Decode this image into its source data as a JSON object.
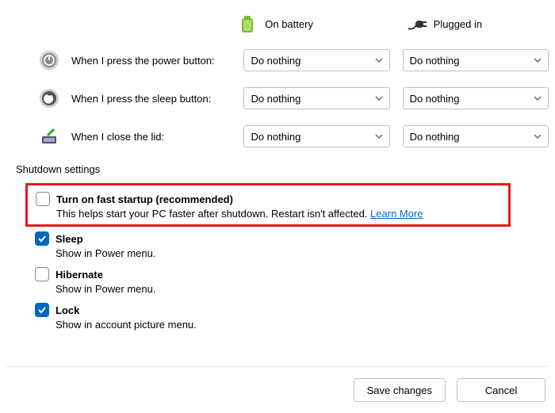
{
  "columnHeaders": {
    "battery": "On battery",
    "pluggedIn": "Plugged in"
  },
  "rows": {
    "powerButton": {
      "label": "When I press the power button:",
      "battery": "Do nothing",
      "plugged": "Do nothing"
    },
    "sleepButton": {
      "label": "When I press the sleep button:",
      "battery": "Do nothing",
      "plugged": "Do nothing"
    },
    "closeLid": {
      "label": "When I close the lid:",
      "battery": "Do nothing",
      "plugged": "Do nothing"
    }
  },
  "shutdownSection": "Shutdown settings",
  "options": {
    "fastStartup": {
      "title": "Turn on fast startup (recommended)",
      "desc": "This helps start your PC faster after shutdown. Restart isn't affected.",
      "learn": "Learn More",
      "checked": false
    },
    "sleep": {
      "title": "Sleep",
      "desc": "Show in Power menu.",
      "checked": true
    },
    "hibernate": {
      "title": "Hibernate",
      "desc": "Show in Power menu.",
      "checked": false
    },
    "lock": {
      "title": "Lock",
      "desc": "Show in account picture menu.",
      "checked": true
    }
  },
  "buttons": {
    "save": "Save changes",
    "cancel": "Cancel"
  }
}
